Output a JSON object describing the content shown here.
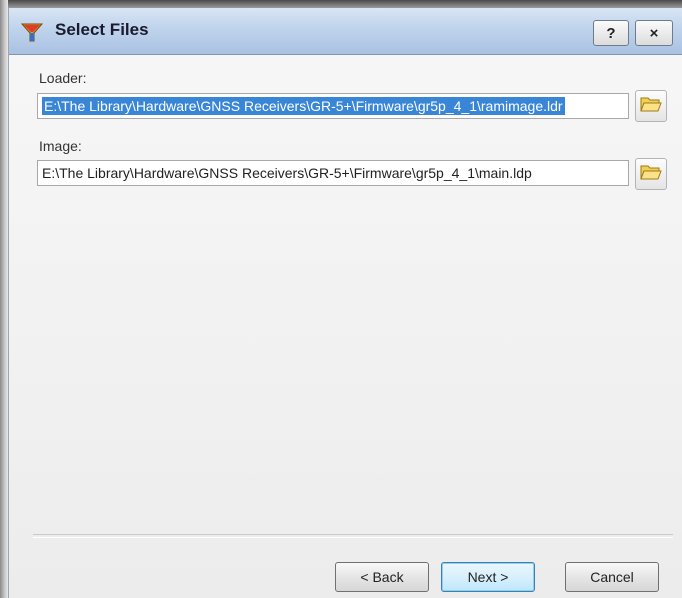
{
  "window": {
    "title": "Select Files",
    "help_label": "?",
    "close_label": "×"
  },
  "loader": {
    "label": "Loader:",
    "value": "E:\\The Library\\Hardware\\GNSS Receivers\\GR-5+\\Firmware\\gr5p_4_1\\ramimage.ldr"
  },
  "image": {
    "label": "Image:",
    "value": "E:\\The Library\\Hardware\\GNSS Receivers\\GR-5+\\Firmware\\gr5p_4_1\\main.ldp"
  },
  "footer": {
    "back_label": "< Back",
    "next_label": "Next >",
    "cancel_label": "Cancel"
  },
  "icons": {
    "title": "funnel-app-icon",
    "browse": "folder-open-icon"
  },
  "colors": {
    "selection": "#3a86d6",
    "titlebar": "#bfd3ec"
  }
}
